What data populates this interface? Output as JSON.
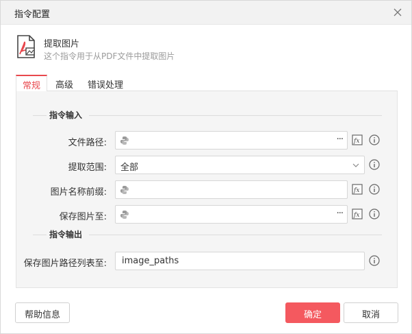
{
  "window": {
    "title": "指令配置"
  },
  "command": {
    "icon": "pdf-image-icon",
    "name": "提取图片",
    "description": "这个指令用于从PDF文件中提取图片"
  },
  "tabs": [
    {
      "label": "常规",
      "active": true
    },
    {
      "label": "高级",
      "active": false
    },
    {
      "label": "错误处理",
      "active": false
    }
  ],
  "sections": {
    "input": {
      "title": "指令输入"
    },
    "output": {
      "title": "指令输出"
    }
  },
  "fields": {
    "file_path": {
      "label": "文件路径:",
      "value": ""
    },
    "extract_range": {
      "label": "提取范围:",
      "value": "全部"
    },
    "name_prefix": {
      "label": "图片名称前缀:",
      "value": ""
    },
    "save_to": {
      "label": "保存图片至:",
      "value": ""
    },
    "output_list": {
      "label": "保存图片路径列表至:",
      "value": "image_paths"
    }
  },
  "buttons": {
    "help": "帮助信息",
    "ok": "确定",
    "cancel": "取消",
    "browse": "···"
  },
  "colors": {
    "accent": "#e8484d",
    "primary_button": "#f4595f",
    "panel_bg": "#f5f5f5"
  }
}
